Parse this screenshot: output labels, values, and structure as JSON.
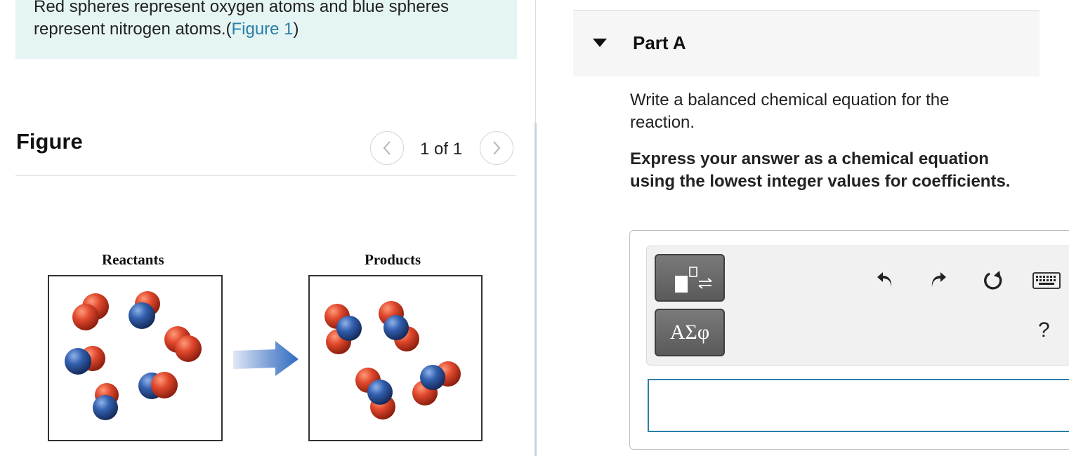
{
  "intro": {
    "text_line1": "Red spheres represent oxygen atoms and blue spheres",
    "text_line2_prefix": "represent nitrogen atoms.(",
    "figure_link": "Figure 1",
    "text_line2_suffix": ")"
  },
  "figure_panel": {
    "title": "Figure",
    "counter": "1 of 1",
    "prev_icon": "chevron-left-icon",
    "next_icon": "chevron-right-icon",
    "reactants_label": "Reactants",
    "products_label": "Products"
  },
  "part_a": {
    "title": "Part A",
    "collapse_icon": "caret-down-icon",
    "question": "Write a balanced chemical equation for the reaction.",
    "instruction": "Express your answer as a chemical equation using the lowest integer values for coefficients."
  },
  "toolbar": {
    "greek_label": "ΑΣφ",
    "help_label": "?",
    "templates_icon": "templates-icon",
    "undo_icon": "undo-icon",
    "redo_icon": "redo-icon",
    "reset_icon": "reset-icon",
    "keyboard_icon": "keyboard-icon"
  },
  "answer": {
    "value": ""
  },
  "colors": {
    "oxygen": "#d9452b",
    "nitrogen": "#2f5aa6",
    "link": "#2a7ea8",
    "intro_background": "#e5f5f4",
    "arrow": "#2e6bc2"
  }
}
